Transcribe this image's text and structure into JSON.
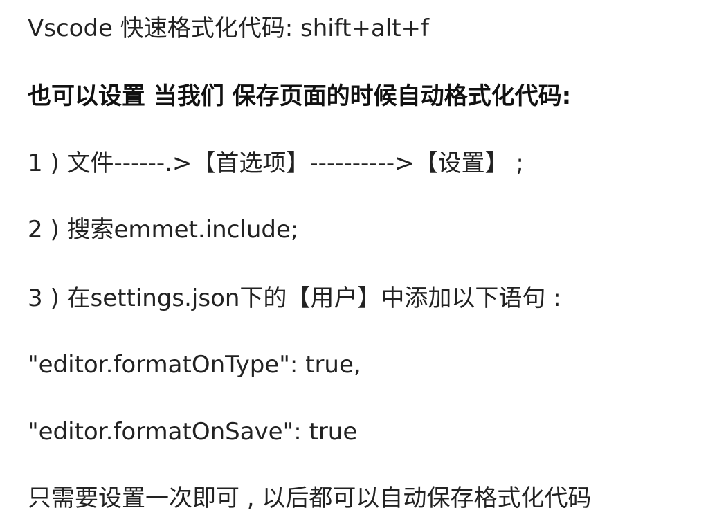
{
  "document": {
    "lines": [
      "Vscode  快速格式化代码:   shift+alt+f",
      "也可以设置 当我们 保存页面的时候自动格式化代码:",
      "1 ) 文件------.>【首选项】---------->【设置】 ;",
      "2 ) 搜索emmet.include;",
      "3 ) 在settings.json下的【用户】中添加以下语句 :",
      "\"editor.formatOnType\": true,",
      "\"editor.formatOnSave\": true",
      "只需要设置一次即可 , 以后都可以自动保存格式化代码"
    ]
  }
}
